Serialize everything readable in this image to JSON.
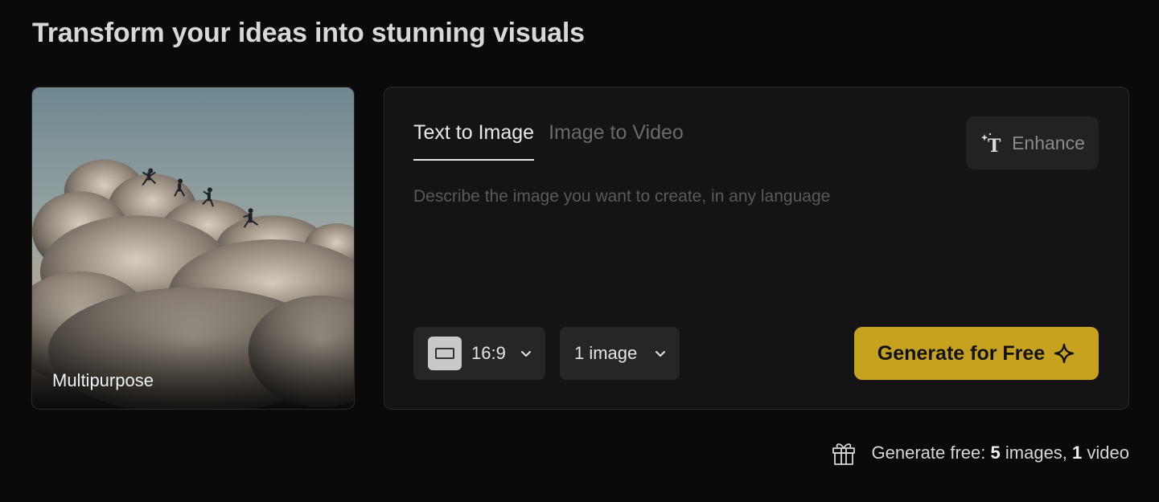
{
  "page": {
    "title": "Transform your ideas into stunning visuals"
  },
  "preview": {
    "label": "Multipurpose",
    "image_alt": "People leaping across clouds at dusk"
  },
  "tabs": [
    {
      "label": "Text to Image",
      "active": true
    },
    {
      "label": "Image to Video",
      "active": false
    }
  ],
  "enhance": {
    "label": "Enhance",
    "icon": "sparkle-text-icon"
  },
  "prompt": {
    "placeholder": "Describe the image you want to create, in any language",
    "value": ""
  },
  "aspect_ratio": {
    "selected": "16:9",
    "icon": "ratio-rectangle-icon"
  },
  "image_count": {
    "selected": "1 image"
  },
  "generate": {
    "label": "Generate for Free",
    "icon": "sparkle-icon",
    "color": "#c7a21f"
  },
  "free_quota": {
    "prefix": "Generate free: ",
    "images_count": "5",
    "images_word": " images, ",
    "video_count": "1",
    "video_word": " video",
    "icon": "gift-icon"
  }
}
